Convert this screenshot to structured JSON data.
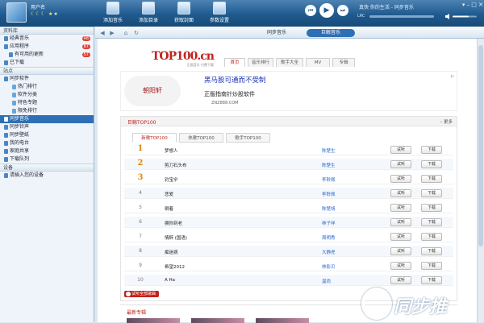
{
  "header": {
    "user_name": "用户名",
    "user_level": "☾☾☾ ★★",
    "toolbar": [
      {
        "label": "添加音乐",
        "icon": "music-add-icon"
      },
      {
        "label": "添加目录",
        "icon": "folder-add-icon"
      },
      {
        "label": "获取封面",
        "icon": "cover-fetch-icon"
      },
      {
        "label": "参数设置",
        "icon": "settings-icon"
      }
    ],
    "player": {
      "prev": "⏮",
      "play": "▶",
      "next": "⏭"
    },
    "now_playing": "真快 你的生活 - 同步音乐",
    "lrc": "LRC",
    "window_controls": "▾ – □ ✕"
  },
  "sidebar": {
    "section_library": "资料库",
    "library_items": [
      {
        "label": "经典音乐",
        "badge": "48",
        "level": 1
      },
      {
        "label": "应用程序",
        "badge": "87",
        "level": 1
      },
      {
        "label": "有可用的更新",
        "badge": "57",
        "level": 2
      },
      {
        "label": "已下载",
        "badge": "",
        "level": 1
      }
    ],
    "section_station": "站点",
    "station_items": [
      {
        "label": "同步软件",
        "level": 1,
        "selected": false
      },
      {
        "label": "热门排行",
        "level": 2,
        "selected": false
      },
      {
        "label": "软件分类",
        "level": 2,
        "selected": false
      },
      {
        "label": "特色专题",
        "level": 2,
        "selected": false
      },
      {
        "label": "限免排行",
        "level": 2,
        "selected": false
      },
      {
        "label": "同步音乐",
        "level": 1,
        "selected": true
      },
      {
        "label": "同步铃声",
        "level": 1,
        "selected": false
      },
      {
        "label": "同步壁纸",
        "level": 1,
        "selected": false
      },
      {
        "label": "我的电台",
        "level": 1,
        "selected": false
      },
      {
        "label": "家庭共享",
        "level": 1,
        "selected": false
      },
      {
        "label": "下载队列",
        "level": 1,
        "selected": false
      }
    ],
    "section_device": "设备",
    "device_items": [
      {
        "label": "请插入您的设备",
        "level": 1
      }
    ]
  },
  "navbar": {
    "back": "◀",
    "forward": "▶",
    "home": "⌂",
    "refresh": "↻",
    "tabs": [
      {
        "label": "同步音乐",
        "active": false
      },
      {
        "label": "巨鲸音乐",
        "active": true
      }
    ]
  },
  "content": {
    "logo": "TOP100.cn",
    "logo_tag": "正版音乐 付费下载",
    "tabs": [
      "首页",
      "音乐排行",
      "歌手大全",
      "MV",
      "专辑"
    ],
    "ad": {
      "logo_text": "朝阳轩",
      "title": "黑马股可通而不受制",
      "subtitle": "正版指南针炒股软件",
      "site": "ZNZ888.COM",
      "corner": "▷"
    },
    "panel": {
      "title": "巨鲸TOP100",
      "more": "› 更多",
      "sub_tabs": [
        {
          "label": "新歌TOP100",
          "active": true
        },
        {
          "label": "热歌TOP100",
          "active": false
        },
        {
          "label": "歌手TOP100",
          "active": false
        }
      ],
      "listen_label": "试听",
      "download_label": "下载",
      "rows": [
        {
          "rank": "1",
          "song": "梦想人",
          "artist": "陈楚生"
        },
        {
          "rank": "2",
          "song": "剪刀石头布",
          "artist": "陈楚生"
        },
        {
          "rank": "3",
          "song": "钓宝伞",
          "artist": "李聆佩"
        },
        {
          "rank": "4",
          "song": "悲爱",
          "artist": "李聆佩"
        },
        {
          "rank": "5",
          "song": "倒着",
          "artist": "陈楚胡"
        },
        {
          "rank": "6",
          "song": "拥你到老",
          "artist": "林子祥"
        },
        {
          "rank": "7",
          "song": "情醉 (国语)",
          "artist": "周明秀"
        },
        {
          "rank": "8",
          "song": "痴迷病",
          "artist": "大静虎"
        },
        {
          "rank": "9",
          "song": "希望2012",
          "artist": "林影贝"
        },
        {
          "rank": "10",
          "song": "A Ha",
          "artist": "温尚"
        }
      ],
      "play_all": "试听全部歌曲"
    },
    "recommended_title": "最新专辑"
  },
  "watermark": "同步推",
  "colors": {
    "header_blue": "#1f5a8e",
    "selected_blue": "#2f6fb5",
    "brand_red": "#c0231d",
    "link_blue": "#2a66c9"
  }
}
